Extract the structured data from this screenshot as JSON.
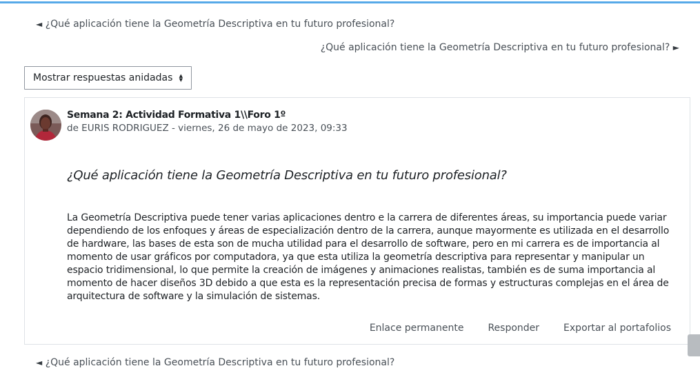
{
  "navigation": {
    "prev_top_label": "¿Qué aplicación tiene la Geometría Descriptiva en tu futuro profesional?",
    "next_top_label": "¿Qué aplicación tiene la Geometría Descriptiva en tu futuro profesional?",
    "prev_bottom_label": "¿Qué aplicación tiene la Geometría Descriptiva en tu futuro profesional?",
    "prev_arrow": "◄",
    "next_arrow": "►"
  },
  "display_mode": {
    "selected": "Mostrar respuestas anidadas"
  },
  "post": {
    "forum_title": "Semana 2: Actividad Formativa 1\\\\Foro 1º",
    "by_prefix": "de",
    "author": "EURIS RODRIGUEZ",
    "date": "- viernes, 26 de mayo de 2023, 09:33",
    "subject": "¿Qué aplicación tiene la Geometría Descriptiva en tu futuro profesional?",
    "body": "La Geometría Descriptiva puede tener varias aplicaciones dentro e la carrera de diferentes áreas,  su importancia puede variar dependiendo de los enfoques y áreas de especialización dentro de la carrera, aunque mayormente es utilizada en el desarrollo de hardware, las bases de esta son de mucha utilidad para el desarrollo de software, pero en mi carrera es de importancia al momento de usar gráficos por computadora, ya que esta utiliza la geometría descriptiva para representar y manipular un espacio tridimensional, lo que permite la creación de imágenes y animaciones realistas,  también es de suma importancia al momento de hacer diseños 3D debido a que esta es la representación precisa de formas y estructuras complejas en el área de arquitectura de software y la simulación de sistemas.",
    "actions": {
      "permalink": "Enlace permanente",
      "reply": "Responder",
      "export": "Exportar al portafolios"
    }
  },
  "colors": {
    "accent_rule": "#56a9e8",
    "border": "#dee2e6",
    "text": "#1d2125",
    "muted": "#495057"
  }
}
